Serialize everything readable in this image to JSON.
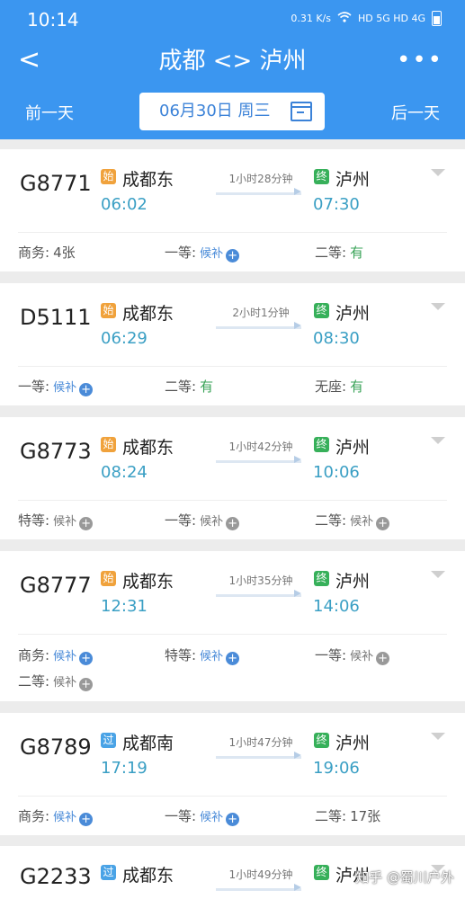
{
  "status": {
    "time": "10:14",
    "net": "0.31 K/s",
    "icons": "HD 5G HD 4G"
  },
  "header": {
    "title": "成都 <> 泸州",
    "prev_day": "前一天",
    "next_day": "后一天",
    "date": "06月30日 周三",
    "back": "<",
    "more": "•••"
  },
  "badges": {
    "start": "始",
    "pass": "过",
    "end": "终"
  },
  "trains": [
    {
      "no": "G8771",
      "from": "成都东",
      "from_badge": "始",
      "dep": "06:02",
      "duration": "1小时28分钟",
      "to": "泸州",
      "to_badge": "终",
      "arr": "07:30",
      "seats": [
        {
          "label": "商务:",
          "value": "4张",
          "type": "count"
        },
        {
          "label": "一等:",
          "value": "候补",
          "type": "hb-blue"
        },
        {
          "label": "二等:",
          "value": "有",
          "type": "avail"
        }
      ]
    },
    {
      "no": "D5111",
      "from": "成都东",
      "from_badge": "始",
      "dep": "06:29",
      "duration": "2小时1分钟",
      "to": "泸州",
      "to_badge": "终",
      "arr": "08:30",
      "seats": [
        {
          "label": "一等:",
          "value": "候补",
          "type": "hb-blue"
        },
        {
          "label": "二等:",
          "value": "有",
          "type": "avail"
        },
        {
          "label": "无座:",
          "value": "有",
          "type": "avail"
        }
      ]
    },
    {
      "no": "G8773",
      "from": "成都东",
      "from_badge": "始",
      "dep": "08:24",
      "duration": "1小时42分钟",
      "to": "泸州",
      "to_badge": "终",
      "arr": "10:06",
      "seats": [
        {
          "label": "特等:",
          "value": "候补",
          "type": "hb-gray"
        },
        {
          "label": "一等:",
          "value": "候补",
          "type": "hb-gray"
        },
        {
          "label": "二等:",
          "value": "候补",
          "type": "hb-gray"
        }
      ]
    },
    {
      "no": "G8777",
      "from": "成都东",
      "from_badge": "始",
      "dep": "12:31",
      "duration": "1小时35分钟",
      "to": "泸州",
      "to_badge": "终",
      "arr": "14:06",
      "seats": [
        {
          "label": "商务:",
          "value": "候补",
          "type": "hb-blue"
        },
        {
          "label": "特等:",
          "value": "候补",
          "type": "hb-blue"
        },
        {
          "label": "一等:",
          "value": "候补",
          "type": "hb-gray"
        },
        {
          "label": "二等:",
          "value": "候补",
          "type": "hb-gray"
        }
      ]
    },
    {
      "no": "G8789",
      "from": "成都南",
      "from_badge": "过",
      "dep": "17:19",
      "duration": "1小时47分钟",
      "to": "泸州",
      "to_badge": "终",
      "arr": "19:06",
      "seats": [
        {
          "label": "商务:",
          "value": "候补",
          "type": "hb-blue"
        },
        {
          "label": "一等:",
          "value": "候补",
          "type": "hb-blue"
        },
        {
          "label": "二等:",
          "value": "17张",
          "type": "count"
        }
      ]
    },
    {
      "no": "G2233",
      "from": "成都东",
      "from_badge": "过",
      "dep": "",
      "duration": "1小时49分钟",
      "to": "泸州",
      "to_badge": "终",
      "arr": "",
      "seats": []
    }
  ],
  "watermark": "知乎 @蜀川户外"
}
